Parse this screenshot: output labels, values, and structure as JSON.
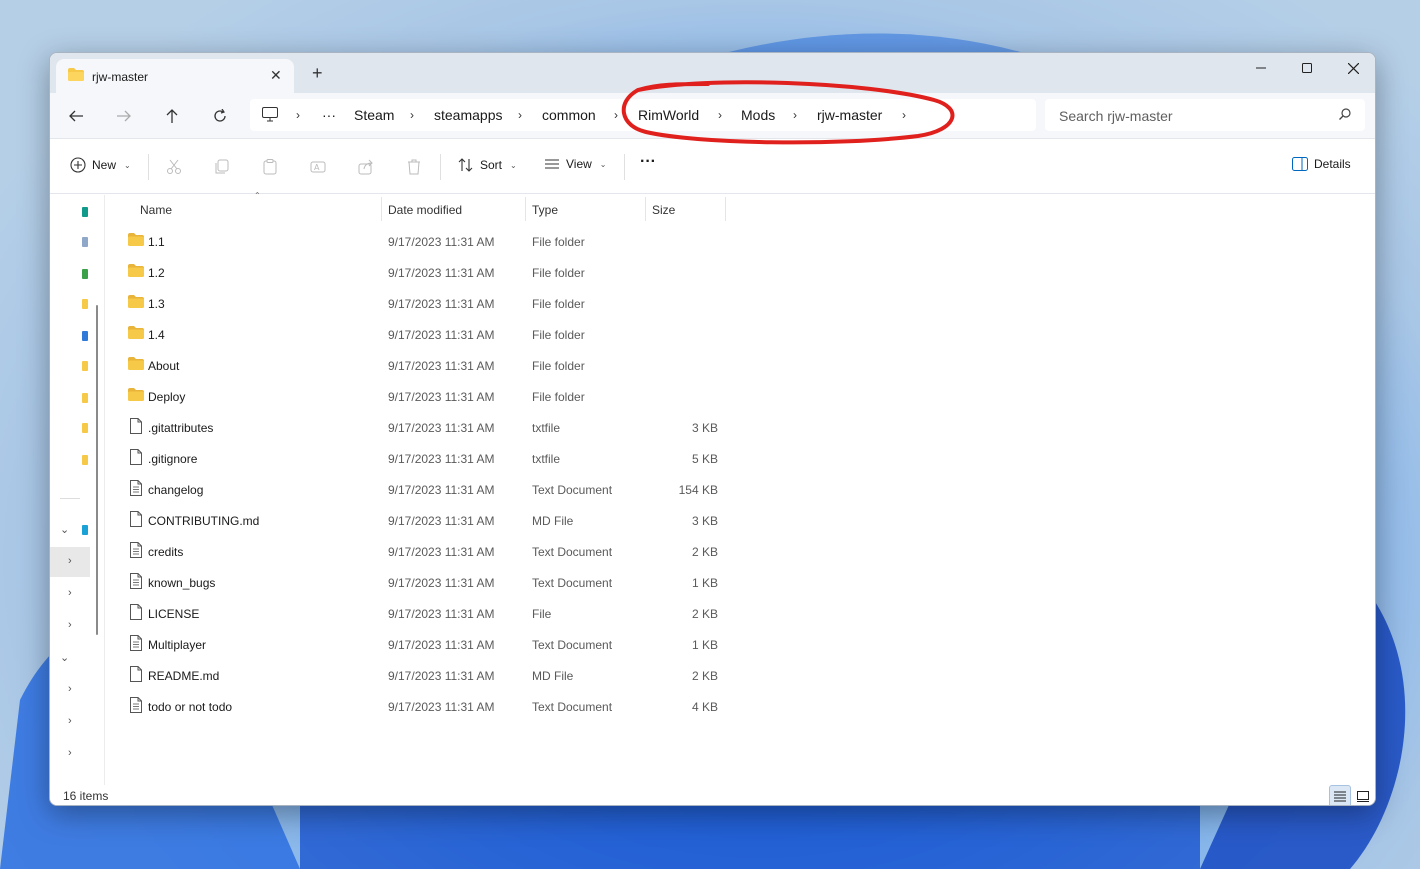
{
  "window": {
    "tab_title": "rjw-master"
  },
  "breadcrumb": {
    "items": [
      "Steam",
      "steamapps",
      "common",
      "RimWorld",
      "Mods",
      "rjw-master"
    ]
  },
  "search": {
    "placeholder": "Search rjw-master"
  },
  "toolbar": {
    "new_label": "New",
    "sort_label": "Sort",
    "view_label": "View",
    "details_label": "Details"
  },
  "columns": {
    "name": "Name",
    "date": "Date modified",
    "type": "Type",
    "size": "Size"
  },
  "files": [
    {
      "name": "1.1",
      "date": "9/17/2023 11:31 AM",
      "type": "File folder",
      "size": "",
      "kind": "folder"
    },
    {
      "name": "1.2",
      "date": "9/17/2023 11:31 AM",
      "type": "File folder",
      "size": "",
      "kind": "folder"
    },
    {
      "name": "1.3",
      "date": "9/17/2023 11:31 AM",
      "type": "File folder",
      "size": "",
      "kind": "folder"
    },
    {
      "name": "1.4",
      "date": "9/17/2023 11:31 AM",
      "type": "File folder",
      "size": "",
      "kind": "folder"
    },
    {
      "name": "About",
      "date": "9/17/2023 11:31 AM",
      "type": "File folder",
      "size": "",
      "kind": "folder"
    },
    {
      "name": "Deploy",
      "date": "9/17/2023 11:31 AM",
      "type": "File folder",
      "size": "",
      "kind": "folder"
    },
    {
      "name": ".gitattributes",
      "date": "9/17/2023 11:31 AM",
      "type": "txtfile",
      "size": "3 KB",
      "kind": "file"
    },
    {
      "name": ".gitignore",
      "date": "9/17/2023 11:31 AM",
      "type": "txtfile",
      "size": "5 KB",
      "kind": "file"
    },
    {
      "name": "changelog",
      "date": "9/17/2023 11:31 AM",
      "type": "Text Document",
      "size": "154 KB",
      "kind": "text"
    },
    {
      "name": "CONTRIBUTING.md",
      "date": "9/17/2023 11:31 AM",
      "type": "MD File",
      "size": "3 KB",
      "kind": "file"
    },
    {
      "name": "credits",
      "date": "9/17/2023 11:31 AM",
      "type": "Text Document",
      "size": "2 KB",
      "kind": "text"
    },
    {
      "name": "known_bugs",
      "date": "9/17/2023 11:31 AM",
      "type": "Text Document",
      "size": "1 KB",
      "kind": "text"
    },
    {
      "name": "LICENSE",
      "date": "9/17/2023 11:31 AM",
      "type": "File",
      "size": "2 KB",
      "kind": "file"
    },
    {
      "name": "Multiplayer",
      "date": "9/17/2023 11:31 AM",
      "type": "Text Document",
      "size": "1 KB",
      "kind": "text"
    },
    {
      "name": "README.md",
      "date": "9/17/2023 11:31 AM",
      "type": "MD File",
      "size": "2 KB",
      "kind": "file"
    },
    {
      "name": "todo or not todo",
      "date": "9/17/2023 11:31 AM",
      "type": "Text Document",
      "size": "4 KB",
      "kind": "text"
    }
  ],
  "status": {
    "item_count": "16 items"
  },
  "colors": {
    "folder": "#f7c948",
    "annotation": "#e0201c",
    "accent": "#0067c0"
  },
  "icons": [
    "folder-icon",
    "file-icon",
    "text-file-icon",
    "search-icon",
    "monitor-icon"
  ]
}
